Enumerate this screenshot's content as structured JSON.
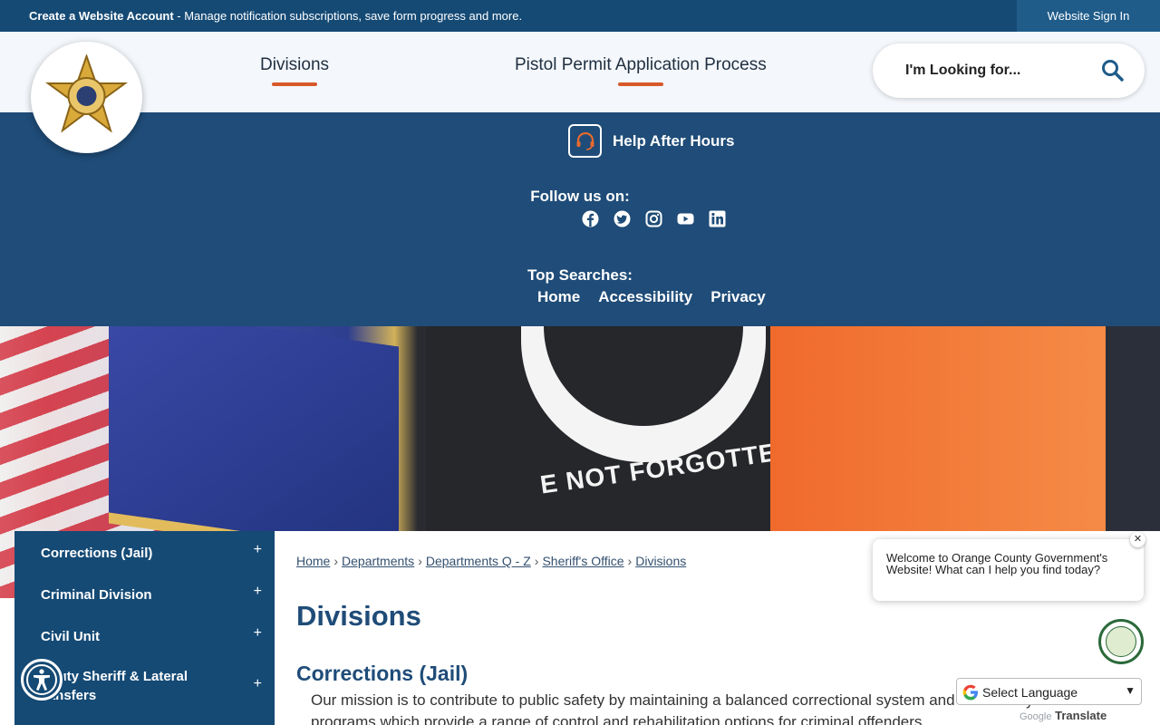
{
  "topbar": {
    "account_link": "Create a Website Account",
    "account_desc": " - Manage notification subscriptions, save form progress and more.",
    "sign_in": "Website Sign In"
  },
  "header": {
    "nav": [
      "Divisions",
      "Pistol Permit Application Process"
    ],
    "search_placeholder": "I'm Looking for..."
  },
  "band": {
    "help": "Help After Hours",
    "follow": "Follow us on:",
    "social": [
      "facebook-icon",
      "twitter-icon",
      "instagram-icon",
      "youtube-icon",
      "linkedin-icon"
    ],
    "top_searches": "Top Searches:",
    "top_links": [
      "Home",
      "Accessibility",
      "Privacy"
    ]
  },
  "hero": {
    "slogan": "E NOT FORGOTTEN"
  },
  "sidebar": {
    "items": [
      {
        "label": "Corrections (Jail)",
        "toggle": "+"
      },
      {
        "label": "Criminal Division",
        "toggle": "+"
      },
      {
        "label": "Civil Unit",
        "toggle": "+"
      },
      {
        "label": "eputy Sheriff & Lateral ransfers",
        "toggle": "+"
      }
    ]
  },
  "content": {
    "breadcrumb": [
      "Home",
      "Departments",
      "Departments Q - Z",
      "Sheriff's Office",
      "Divisions"
    ],
    "title": "Divisions",
    "section_title": "Corrections (Jail)",
    "paragraph": "Our mission is to contribute to public safety by maintaining a balanced correctional system and community programs which provide a range of control and rehabilitation options for criminal offenders."
  },
  "chat": {
    "message": "Welcome to Orange County Government's Website! What can I help you find today?",
    "close": "✕"
  },
  "translate": {
    "select_label": "Select Language",
    "powered_google": "Google",
    "powered_translate": "Translate"
  },
  "colors": {
    "primary": "#154a75",
    "band": "#1f4c78",
    "accent": "#d8582a"
  }
}
